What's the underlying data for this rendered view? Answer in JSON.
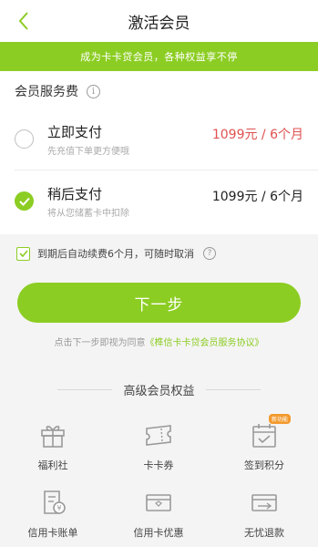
{
  "nav": {
    "title": "激活会员",
    "back_icon": "chevron-left-icon"
  },
  "banner": {
    "text": "成为卡卡贷会员，各种权益享不停"
  },
  "fee": {
    "heading": "会员服务费",
    "info_icon": "info-icon"
  },
  "options": [
    {
      "title": "立即支付",
      "subtitle": "先充值下单更方便哦",
      "price": "1099元 / 6个月",
      "selected": false
    },
    {
      "title": "稍后支付",
      "subtitle": "将从您储蓄卡中扣除",
      "price": "1099元 / 6个月",
      "selected": true
    }
  ],
  "autorenew": {
    "label": "到期后自动续费6个月，可随时取消",
    "checked": true,
    "help_icon": "question-icon"
  },
  "next_button": {
    "label": "下一步"
  },
  "agreement": {
    "prefix": "点击下一步即视为同意",
    "link": "《榫信卡卡贷会员服务协议》"
  },
  "rights": {
    "title": "高级会员权益",
    "items": [
      {
        "label": "福利社",
        "icon": "gift-icon"
      },
      {
        "label": "卡卡券",
        "icon": "ticket-icon"
      },
      {
        "label": "签到积分",
        "icon": "calendar-check-icon",
        "badge": "新功能"
      },
      {
        "label": "信用卡账单",
        "icon": "bill-icon"
      },
      {
        "label": "信用卡优惠",
        "icon": "discount-card-icon"
      },
      {
        "label": "无忧退款",
        "icon": "refund-card-icon"
      }
    ]
  },
  "colors": {
    "accent": "#8ccd23",
    "price_red": "#e05050",
    "badge": "#f39a2e"
  }
}
